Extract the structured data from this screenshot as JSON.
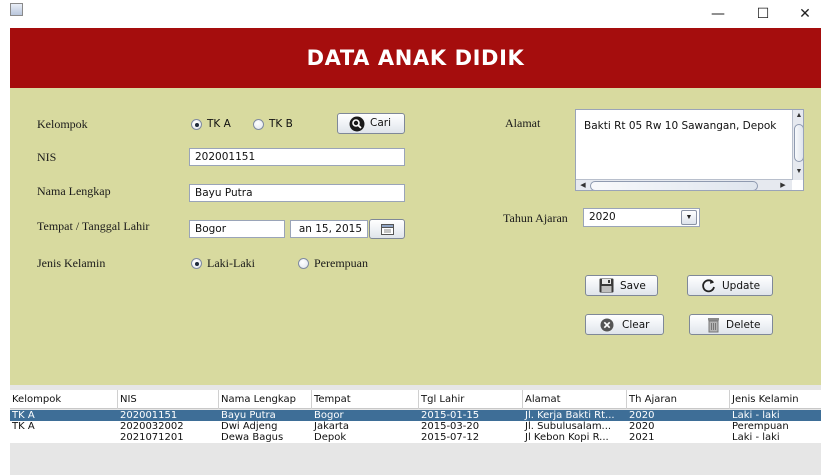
{
  "window": {
    "minimize": "—",
    "maximize": "☐",
    "close": "✕"
  },
  "header": {
    "title": "DATA ANAK DIDIK",
    "bg_color": "#a50d0d"
  },
  "form": {
    "bg_color": "#d8da9f",
    "kelompok": {
      "label": "Kelompok",
      "options": [
        "TK A",
        "TK B"
      ],
      "selected": "TK A",
      "search_button": "Cari"
    },
    "nis": {
      "label": "NIS",
      "value": "202001151"
    },
    "nama": {
      "label": "Nama Lengkap",
      "value": "Bayu Putra"
    },
    "ttl": {
      "label": "Tempat / Tanggal Lahir",
      "tempat": "Bogor",
      "tanggal": "an 15, 2015"
    },
    "jenis_kelamin": {
      "label": "Jenis Kelamin",
      "options": [
        "Laki-Laki",
        "Perempuan"
      ],
      "selected": "Laki-Laki"
    },
    "alamat": {
      "label": "Alamat",
      "value": "Bakti Rt 05 Rw 10 Sawangan, Depok"
    },
    "tahun_ajaran": {
      "label": "Tahun Ajaran",
      "value": "2020"
    },
    "buttons": {
      "save": "Save",
      "update": "Update",
      "clear": "Clear",
      "delete": "Delete"
    }
  },
  "table": {
    "columns": [
      "Kelompok",
      "NIS",
      "Nama Lengkap",
      "Tempat",
      "Tgl Lahir",
      "Alamat",
      "Th Ajaran",
      "Jenis Kelamin"
    ],
    "rows": [
      {
        "selected": true,
        "cells": [
          "TK A",
          "202001151",
          "Bayu Putra",
          "Bogor",
          "2015-01-15",
          "Jl. Kerja Bakti Rt...",
          "2020",
          "Laki - laki"
        ]
      },
      {
        "selected": false,
        "cells": [
          "TK A",
          "2020032002",
          "Dwi Adjeng",
          "Jakarta",
          "2015-03-20",
          "Jl. Subulusalam...",
          "2020",
          "Perempuan"
        ]
      },
      {
        "selected": false,
        "cells": [
          "",
          "2021071201",
          "Dewa Bagus",
          "Depok",
          "2015-07-12",
          "Jl Kebon Kopi R...",
          "2021",
          "Laki - laki"
        ]
      }
    ],
    "selected_color": "#3e6e97"
  }
}
